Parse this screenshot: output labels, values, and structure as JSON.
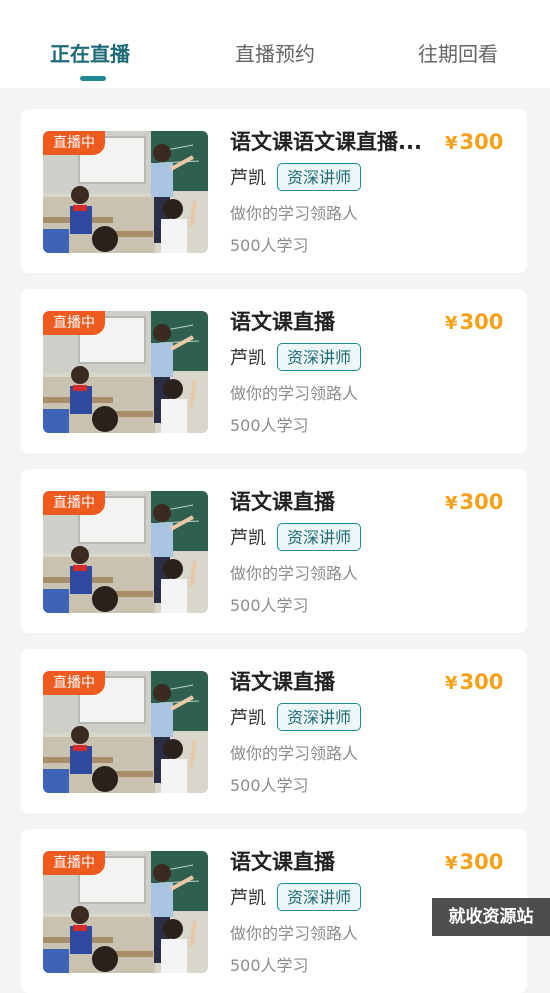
{
  "tabs": [
    {
      "label": "正在直播",
      "active": true
    },
    {
      "label": "直播预约",
      "active": false
    },
    {
      "label": "往期回看",
      "active": false
    }
  ],
  "courses": [
    {
      "badge": "直播中",
      "title": "语文课语文课直播...",
      "currency": "¥",
      "price": "300",
      "teacher": "芦凯",
      "teacher_tag": "资深讲师",
      "slogan": "做你的学习领路人",
      "students": "500人学习"
    },
    {
      "badge": "直播中",
      "title": "语文课直播",
      "currency": "¥",
      "price": "300",
      "teacher": "芦凯",
      "teacher_tag": "资深讲师",
      "slogan": "做你的学习领路人",
      "students": "500人学习"
    },
    {
      "badge": "直播中",
      "title": "语文课直播",
      "currency": "¥",
      "price": "300",
      "teacher": "芦凯",
      "teacher_tag": "资深讲师",
      "slogan": "做你的学习领路人",
      "students": "500人学习"
    },
    {
      "badge": "直播中",
      "title": "语文课直播",
      "currency": "¥",
      "price": "300",
      "teacher": "芦凯",
      "teacher_tag": "资深讲师",
      "slogan": "做你的学习领路人",
      "students": "500人学习"
    },
    {
      "badge": "直播中",
      "title": "语文课直播",
      "currency": "¥",
      "price": "300",
      "teacher": "芦凯",
      "teacher_tag": "资深讲师",
      "slogan": "做你的学习领路人",
      "students": "500人学习"
    }
  ],
  "watermark": "就收资源站",
  "colors": {
    "accent": "#1e8a93",
    "live_badge": "#ef5a1f",
    "price": "#f5a11c",
    "page_bg": "#f4f4f4"
  }
}
